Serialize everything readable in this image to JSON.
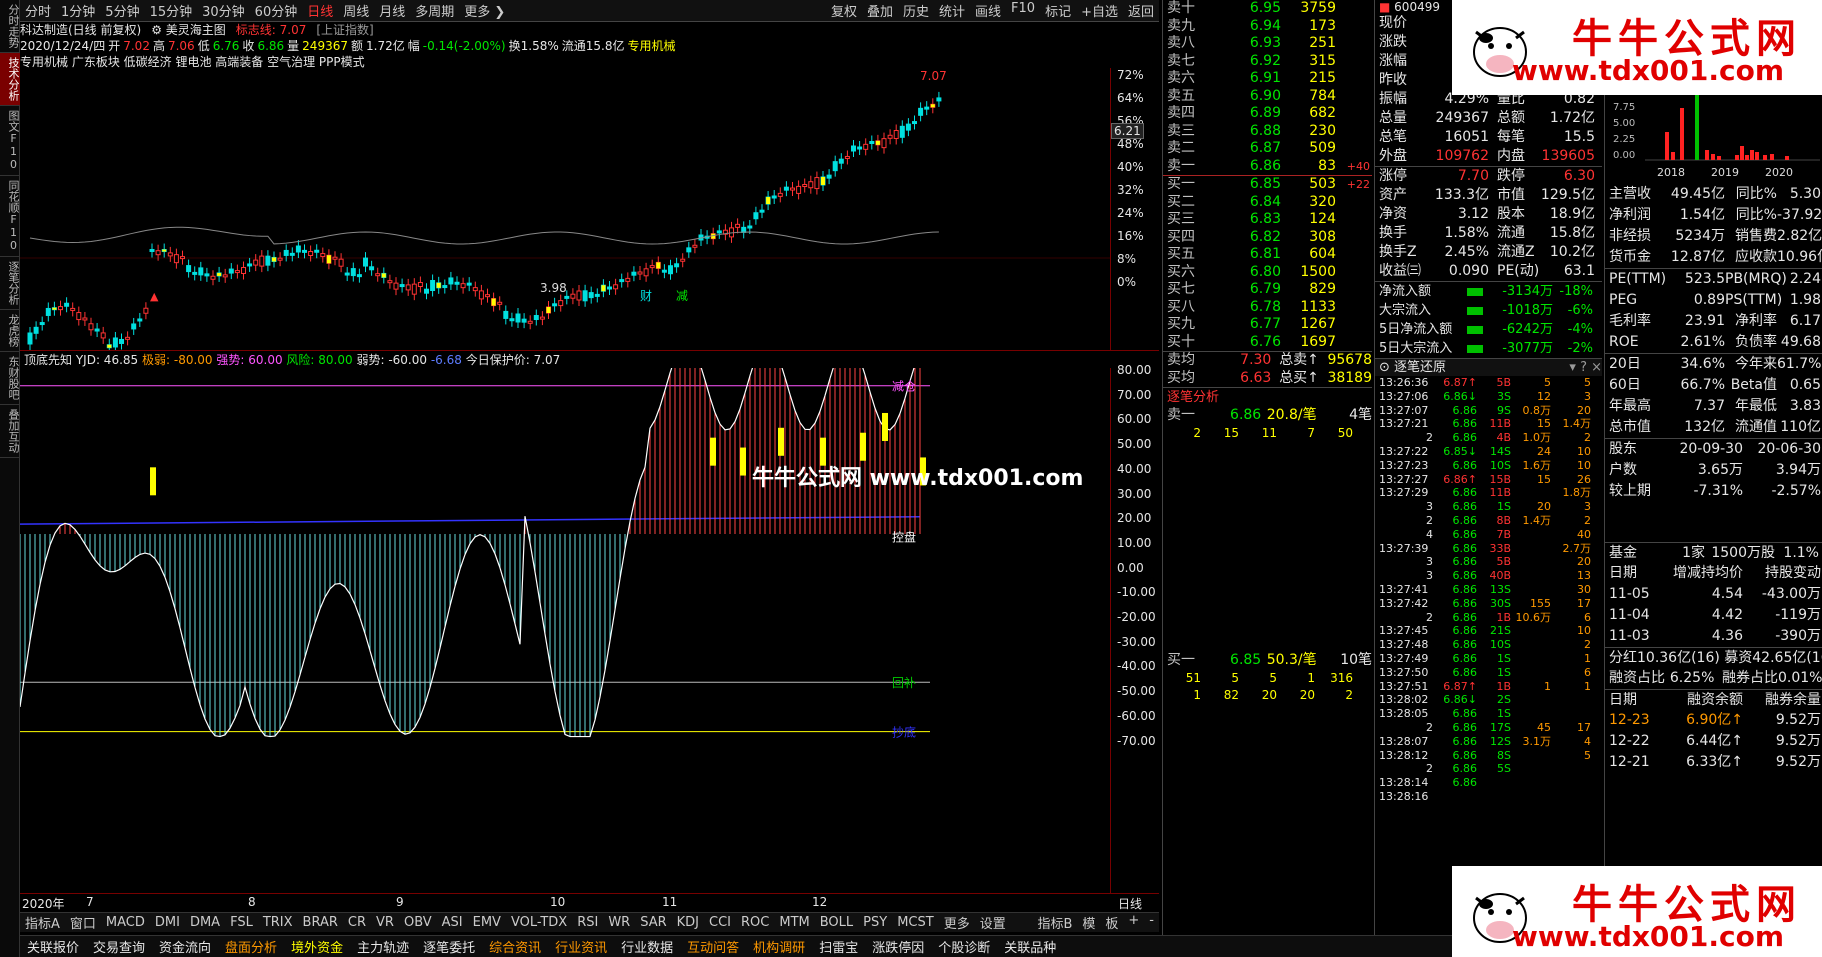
{
  "left_tabs": [
    "分时走势",
    "技术分析",
    "图文F10",
    "同花顺F10",
    "逐笔分析",
    "龙虎榜",
    "东财股吧",
    "叠加互动"
  ],
  "period_bar": {
    "items": [
      "分时",
      "1分钟",
      "5分钟",
      "15分钟",
      "30分钟",
      "60分钟",
      "日线",
      "周线",
      "月线",
      "多周期",
      "更多 ❯"
    ],
    "selected": "日线",
    "right": [
      "复权",
      "叠加",
      "历史",
      "统计",
      "画线",
      "F10",
      "标记",
      "+自选",
      "返回"
    ]
  },
  "info": {
    "stock": "科达制造(日线 前复权)",
    "formula": "美灵海主图",
    "marker": "标志线: 7.07",
    "index": "[上证指数]",
    "line2": {
      "date": "2020/12/24/四",
      "open_lbl": "开",
      "open": "7.02",
      "high_lbl": "高",
      "high": "7.06",
      "low_lbl": "低",
      "low": "6.76",
      "close_lbl": "收",
      "close": "6.86",
      "vol_lbl": "量",
      "vol": "249367",
      "amt_lbl": "额",
      "amt": "1.72亿",
      "chg_lbl": "幅",
      "chg": "-0.14(-2.00%)",
      "turn": "换1.58%",
      "float": "流通15.8亿",
      "sector": "专用机械"
    },
    "tags": "专用机械  广东板块  低碳经济  锂电池  高端装备  空气治理  PPP模式"
  },
  "main_chart": {
    "hi_label": "7.37",
    "hi_label2": "7.07",
    "lo_label": "3.98",
    "markers": [
      "财",
      "减"
    ],
    "right_tag": "6.21"
  },
  "price_axis": [
    "72%",
    "64%",
    "56%",
    "48%",
    "40%",
    "32%",
    "24%",
    "16%",
    "8%",
    "0%"
  ],
  "indicator": {
    "name": "顶底先知",
    "yjd": "YJD: 46.85",
    "jr": "极弱: -80.00",
    "qs": "强势: 60.00",
    "fx": "风险: 80.00",
    "rs": "弱势: -60.00",
    "blue": "-6.68",
    "protect": "今日保护价: 7.07",
    "labels": {
      "qc": "清仓",
      "jc": "减仓",
      "kp": "控盘",
      "hb": "回补",
      "bottom": "抄底"
    }
  },
  "ind_axis": [
    "80.00",
    "70.00",
    "60.00",
    "50.00",
    "40.00",
    "30.00",
    "20.00",
    "10.00",
    "0.00",
    "-10.00",
    "-20.00",
    "-30.00",
    "-40.00",
    "-50.00",
    "-60.00",
    "-70.00"
  ],
  "date_axis": [
    "2020年",
    "7",
    "8",
    "9",
    "10",
    "11",
    "12"
  ],
  "date_axis_right": "日线",
  "ind_tabs": [
    "指标A",
    "窗口",
    "MACD",
    "DMI",
    "DMA",
    "FSL",
    "TRIX",
    "BRAR",
    "CR",
    "VR",
    "OBV",
    "ASI",
    "EMV",
    "VOL-TDX",
    "RSI",
    "WR",
    "SAR",
    "KDJ",
    "CCI",
    "ROC",
    "MTM",
    "BOLL",
    "PSY",
    "MCST",
    "更多",
    "设置"
  ],
  "ind_tabs_right": [
    "指标B",
    "模",
    "板",
    "+",
    "-"
  ],
  "bottom_bar": [
    "关联报价",
    "交易查询",
    "资金流向",
    "盘面分析",
    "境外资金",
    "主力轨迹",
    "逐笔委托",
    "综合资讯",
    "行业资讯",
    "行业数据",
    "互动问答",
    "机构调研",
    "扫雷宝",
    "涨跌停因",
    "个股诊断",
    "关联品种",
    "侧边栏",
    "队列",
    "分布",
    "龙虎",
    "风向",
    "笔",
    "价",
    "细"
  ],
  "sell_orders": [
    [
      "卖十",
      "6.95",
      "3759",
      ""
    ],
    [
      "卖九",
      "6.94",
      "173",
      ""
    ],
    [
      "卖八",
      "6.93",
      "251",
      ""
    ],
    [
      "卖七",
      "6.92",
      "315",
      ""
    ],
    [
      "卖六",
      "6.91",
      "215",
      ""
    ],
    [
      "卖五",
      "6.90",
      "784",
      ""
    ],
    [
      "卖四",
      "6.89",
      "682",
      ""
    ],
    [
      "卖三",
      "6.88",
      "230",
      ""
    ],
    [
      "卖二",
      "6.87",
      "509",
      ""
    ],
    [
      "卖一",
      "6.86",
      "83",
      "+40"
    ]
  ],
  "buy_orders": [
    [
      "买一",
      "6.85",
      "503",
      "+22"
    ],
    [
      "买二",
      "6.84",
      "320",
      ""
    ],
    [
      "买三",
      "6.83",
      "124",
      ""
    ],
    [
      "买四",
      "6.82",
      "308",
      ""
    ],
    [
      "买五",
      "6.81",
      "604",
      ""
    ],
    [
      "买六",
      "6.80",
      "1500",
      ""
    ],
    [
      "买七",
      "6.79",
      "829",
      ""
    ],
    [
      "买八",
      "6.78",
      "1133",
      ""
    ],
    [
      "买九",
      "6.77",
      "1267",
      ""
    ],
    [
      "买十",
      "6.76",
      "1697",
      ""
    ]
  ],
  "avg": {
    "sell_avg_lbl": "卖均",
    "sell_avg": "7.30",
    "sell_total_lbl": "总卖",
    "sell_total": "95678",
    "buy_avg_lbl": "买均",
    "buy_avg": "6.63",
    "buy_total_lbl": "总买",
    "buy_total": "38189"
  },
  "zhubi": {
    "title": "逐笔分析",
    "sell1": "卖一",
    "sell1_p": "6.86",
    "sell1_avg": "20.8/笔",
    "sell1_cnt": "4笔",
    "sell1_q": [
      "2",
      "15",
      "11",
      "7",
      "50"
    ],
    "buy1": "买一",
    "buy1_p": "6.85",
    "buy1_avg": "50.3/笔",
    "buy1_cnt": "10笔",
    "buy1_q": [
      "51",
      "5",
      "5",
      "1",
      "316",
      "1",
      "82",
      "20",
      "20",
      "2"
    ]
  },
  "quote": {
    "code": "600499",
    "rows": [
      [
        "现价",
        "",
        "均价",
        ""
      ],
      [
        "涨跌",
        "",
        "",
        ""
      ],
      [
        "涨幅",
        "-2",
        "",
        ""
      ],
      [
        "昨收",
        "7.00",
        "均价",
        "6.89"
      ],
      [
        "振幅",
        "4.29%",
        "量比",
        "0.82"
      ],
      [
        "总量",
        "249367",
        "总额",
        "1.72亿"
      ],
      [
        "总笔",
        "16051",
        "每笔",
        "15.5"
      ],
      [
        "外盘",
        "109762",
        "内盘",
        "139605"
      ]
    ],
    "rows2": [
      [
        "涨停",
        "7.70",
        "跌停",
        "6.30"
      ],
      [
        "资产",
        "133.3亿",
        "市值",
        "129.5亿"
      ],
      [
        "净资",
        "3.12",
        "股本",
        "18.9亿"
      ],
      [
        "换手",
        "1.58%",
        "流通",
        "15.8亿"
      ],
      [
        "换手Z",
        "2.45%",
        "流通Z",
        "10.2亿"
      ],
      [
        "收益㈢",
        "0.090",
        "PE(动)",
        "63.1"
      ]
    ],
    "flows": [
      [
        "净流入额",
        "-3134万",
        "-18%"
      ],
      [
        "大宗流入",
        "-1018万",
        "-6%"
      ],
      [
        "5日净流入额",
        "-6242万",
        "-4%"
      ],
      [
        "5日大宗流入",
        "-3077万",
        "-2%"
      ]
    ]
  },
  "ticks": {
    "title": "逐笔还原",
    "rows": [
      [
        "13:26:36",
        "6.87↑",
        "5B",
        "5",
        "5"
      ],
      [
        "13:27:06",
        "6.86↓",
        "3S",
        "12",
        "3"
      ],
      [
        "13:27:07",
        "6.86",
        "9S",
        "0.8万",
        "20"
      ],
      [
        "13:27:21",
        "6.86",
        "11B",
        "15",
        "1.4万"
      ],
      [
        "2",
        "6.86",
        "4B",
        "1.0万",
        "2"
      ],
      [
        "13:27:22",
        "6.85↓",
        "14S",
        "24",
        "10"
      ],
      [
        "13:27:23",
        "6.86",
        "10S",
        "1.6万",
        "10"
      ],
      [
        "13:27:27",
        "6.86↑",
        "15B",
        "15",
        "26"
      ],
      [
        "13:27:29",
        "6.86",
        "11B",
        "",
        "1.8万"
      ],
      [
        "3",
        "6.86",
        "1S",
        "20",
        "3"
      ],
      [
        "2",
        "6.86",
        "8B",
        "1.4万",
        "2"
      ],
      [
        "4",
        "6.86",
        "7B",
        "",
        "40"
      ],
      [
        "13:27:39",
        "6.86",
        "33B",
        "",
        "2.7万"
      ],
      [
        "3",
        "6.86",
        "5B",
        "",
        "20"
      ],
      [
        "3",
        "6.86",
        "40B",
        "",
        "13"
      ],
      [
        "13:27:41",
        "6.86",
        "13S",
        "",
        "30"
      ],
      [
        "13:27:42",
        "6.86",
        "30S",
        "155",
        "17"
      ],
      [
        "2",
        "6.86",
        "1B",
        "10.6万",
        "6"
      ],
      [
        "13:27:45",
        "6.86",
        "21S",
        "",
        "10"
      ],
      [
        "13:27:48",
        "6.86",
        "10S",
        "",
        "2"
      ],
      [
        "13:27:49",
        "6.86",
        "1S",
        "",
        "1"
      ],
      [
        "13:27:50",
        "6.86",
        "1S",
        "",
        "6"
      ],
      [
        "13:27:51",
        "6.87↑",
        "1B",
        "1",
        "1"
      ],
      [
        "13:28:02",
        "6.86↓",
        "2S",
        "",
        ""
      ],
      [
        "13:28:05",
        "6.86",
        "1S",
        "",
        ""
      ],
      [
        "2",
        "6.86",
        "17S",
        "45",
        "17"
      ],
      [
        "13:28:07",
        "6.86",
        "12S",
        "3.1万",
        "4"
      ],
      [
        "13:28:12",
        "6.86",
        "8S",
        "",
        "5"
      ],
      [
        "2",
        "6.86",
        "5S",
        "",
        ""
      ],
      [
        "13:28:14",
        "6.86",
        "",
        "",
        ""
      ],
      [
        "13:28:16",
        "",
        "",
        "",
        ""
      ]
    ]
  },
  "fin": {
    "chart_years": [
      "2018",
      "2019",
      "2020"
    ],
    "chart_ticks": [
      "7.75",
      "5.00",
      "2.25",
      "0.00"
    ],
    "rows": [
      [
        "主营收",
        "49.45亿",
        "同比%",
        "5.30"
      ],
      [
        "净利润",
        "1.54亿",
        "同比%",
        "-37.92"
      ],
      [
        "非经损",
        "5234万",
        "销售费",
        "2.82亿"
      ],
      [
        "货币金",
        "12.87亿",
        "应收款",
        "10.96亿"
      ]
    ],
    "rows2": [
      [
        "PE(TTM)",
        "523.5",
        "PB(MRQ)",
        "2.24"
      ],
      [
        "PEG",
        "0.89",
        "PS(TTM)",
        "1.98"
      ],
      [
        "毛利率",
        "23.91",
        "净利率",
        "6.17"
      ],
      [
        "ROE",
        "2.61%",
        "负债率",
        "49.68"
      ]
    ],
    "rows3": [
      [
        "20日",
        "34.6%",
        "今年来",
        "61.7%"
      ],
      [
        "60日",
        "66.7%",
        "Beta值",
        "0.65"
      ],
      [
        "年最高",
        "7.37",
        "年最低",
        "3.83"
      ],
      [
        "总市值",
        "132亿",
        "流通值",
        "110亿"
      ]
    ],
    "holders": [
      [
        "股东",
        "20-09-30",
        "20-06-30"
      ],
      [
        "户数",
        "3.65万",
        "3.94万"
      ],
      [
        "较上期",
        "-7.31%",
        "-2.57%"
      ]
    ],
    "fund": [
      "基金",
      "1家",
      "1500万股",
      "1.1%"
    ],
    "fundhdr": [
      "日期",
      "增减持均价",
      "持股变动"
    ],
    "fundrows": [
      [
        "11-05",
        "4.54",
        "-43.00万"
      ],
      [
        "11-04",
        "4.42",
        "-119万"
      ],
      [
        "11-03",
        "4.36",
        "-390万"
      ]
    ],
    "div": "分红10.36亿(16) 募资42.65亿(16)",
    "margin_ratio": [
      "融资占比",
      "6.25%",
      "融券占比",
      "0.01%"
    ],
    "marginhdr": [
      "日期",
      "融资余额",
      "融券余量"
    ],
    "marginrows": [
      [
        "12-23",
        "6.90亿↑",
        "9.52万"
      ],
      [
        "12-22",
        "6.44亿↑",
        "9.52万"
      ],
      [
        "12-21",
        "6.33亿↑",
        "9.52万"
      ]
    ]
  },
  "watermark": {
    "title": "牛牛公式网",
    "url": "www.tdx001.com",
    "center": "牛牛公式网 www.tdx001.com"
  },
  "colors": {
    "up": "#ff3333",
    "down": "#00e0e0",
    "volume": "#ffff00",
    "accent": "#ff3333"
  }
}
